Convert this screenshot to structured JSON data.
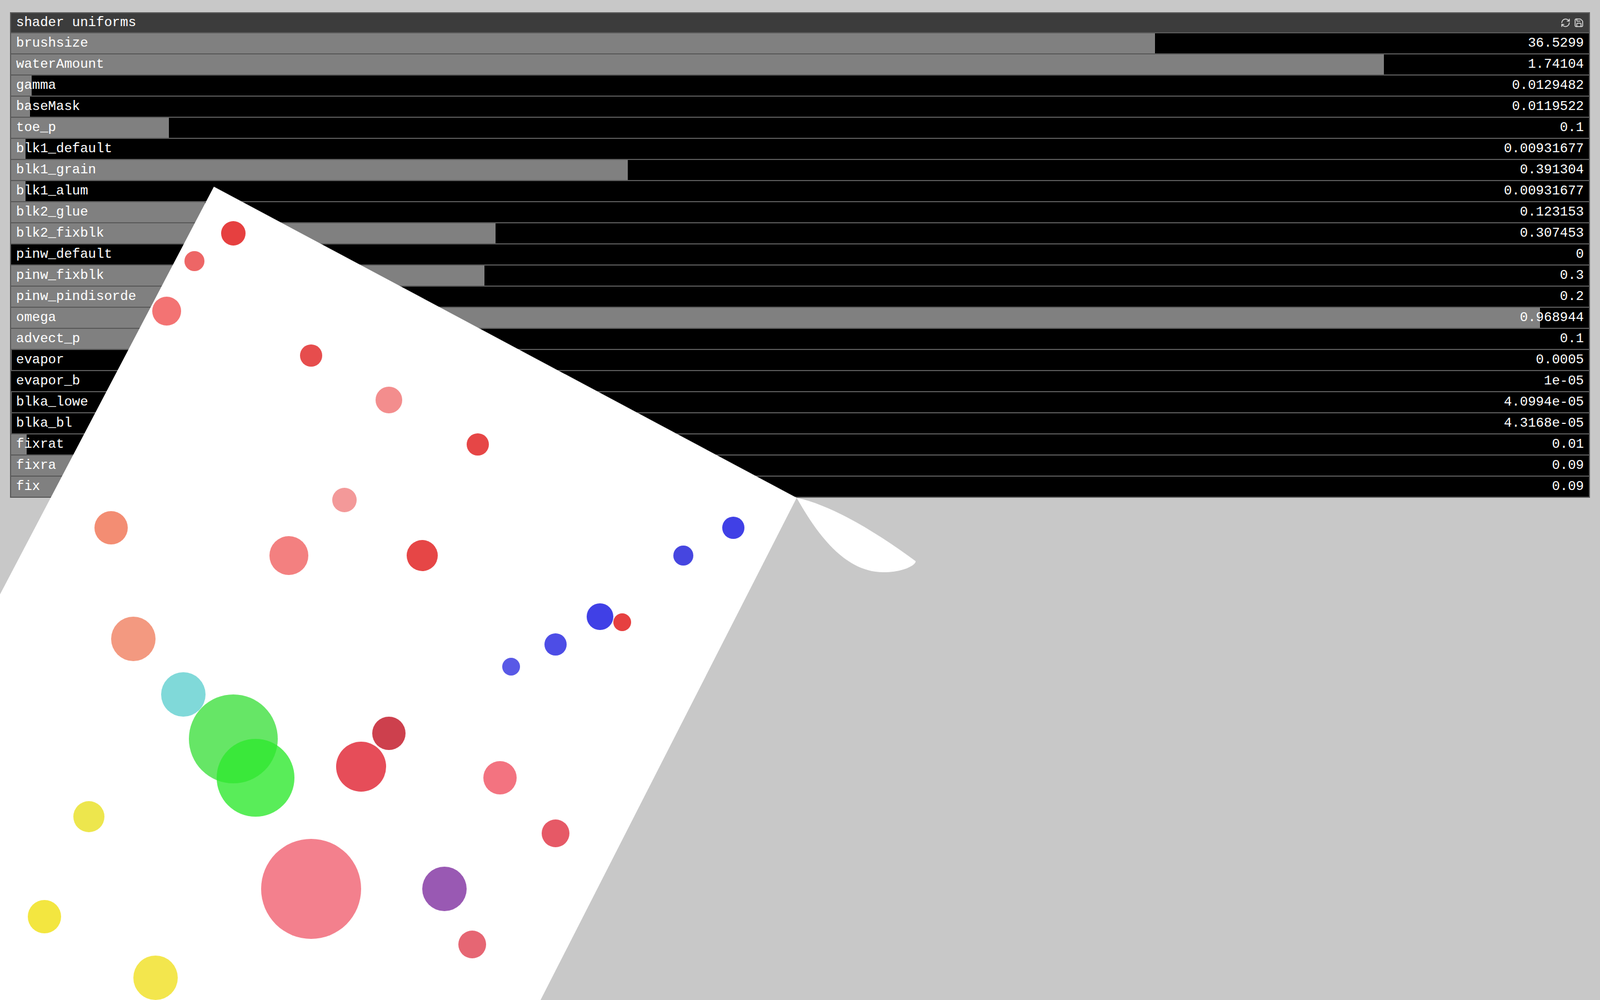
{
  "window": {
    "title": "shader uniforms"
  },
  "uniforms": [
    {
      "name": "brushsize",
      "value": "36.5299",
      "level": 0.725
    },
    {
      "name": "waterAmount",
      "value": "1.74104",
      "level": 0.87
    },
    {
      "name": "gamma",
      "value": "0.0129482",
      "level": 0.013
    },
    {
      "name": "baseMask",
      "value": "0.0119522",
      "level": 0.012
    },
    {
      "name": "toe_p",
      "value": "0.1",
      "level": 0.1
    },
    {
      "name": "blk1_default",
      "value": "0.00931677",
      "level": 0.0093
    },
    {
      "name": "blk1_grain",
      "value": "0.391304",
      "level": 0.391
    },
    {
      "name": "blk1_alum",
      "value": "0.00931677",
      "level": 0.0093
    },
    {
      "name": "blk2_glue",
      "value": "0.123153",
      "level": 0.123
    },
    {
      "name": "blk2_fixblk",
      "value": "0.307453",
      "level": 0.307
    },
    {
      "name": "pinw_default",
      "value": "0",
      "level": 0
    },
    {
      "name": "pinw_fixblk",
      "value": "0.3",
      "level": 0.3
    },
    {
      "name": "pinw_pindisorde",
      "value": "0.2",
      "level": 0.2
    },
    {
      "name": "omega",
      "value": "0.968944",
      "level": 0.969
    },
    {
      "name": "advect_p",
      "value": "0.1",
      "level": 0.1
    },
    {
      "name": "evapor",
      "value": "0.0005",
      "level": 0.0005
    },
    {
      "name": "evapor_b",
      "value": "1e-05",
      "level": 1e-05
    },
    {
      "name": "blka_lowe",
      "value": "4.0994e-05",
      "level": 4e-05
    },
    {
      "name": "blka_bl",
      "value": "4.3168e-05",
      "level": 4e-05
    },
    {
      "name": "fixrat",
      "value": "0.01",
      "level": 0.01
    },
    {
      "name": "fixra",
      "value": "0.09",
      "level": 0.09
    },
    {
      "name": "fix",
      "value": "0.09",
      "level": 0.09
    }
  ]
}
